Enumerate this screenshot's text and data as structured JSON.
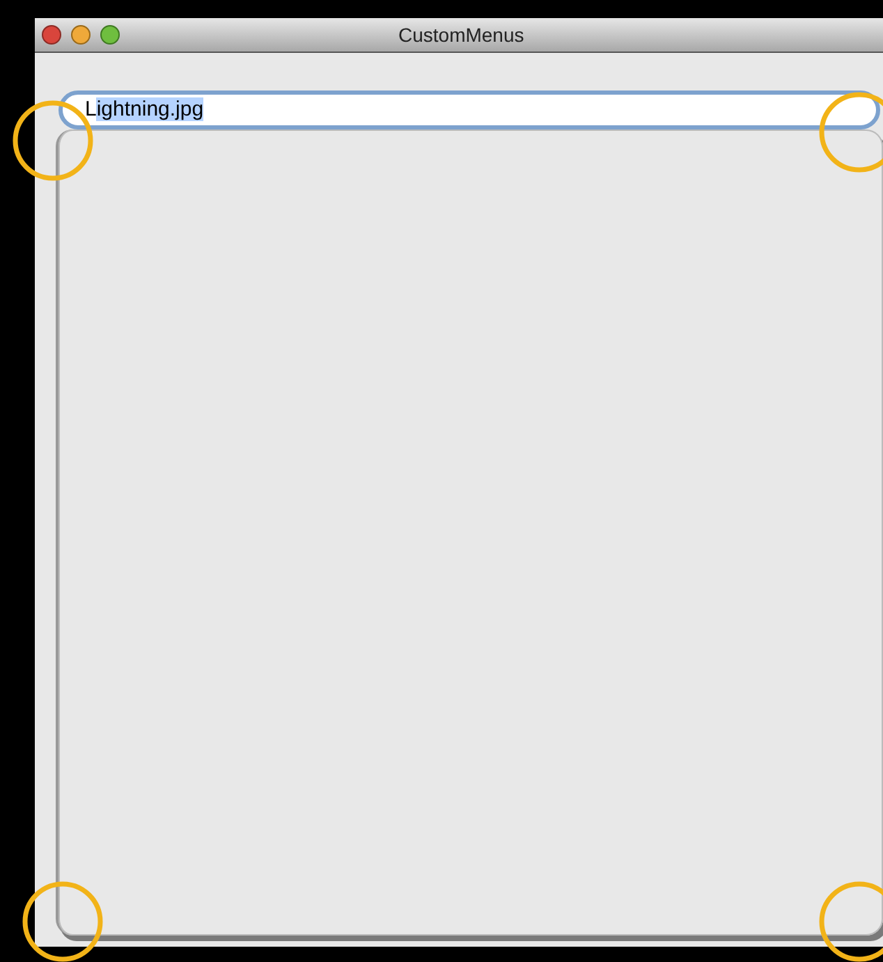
{
  "window": {
    "title": "CustomMenus"
  },
  "text_field": {
    "parts": [
      {
        "text": "L",
        "selected": false
      },
      {
        "text": "ightning.jpg",
        "selected": true
      }
    ]
  },
  "corner_markers": [
    {
      "kind": "circle"
    },
    {
      "kind": "circle"
    },
    {
      "kind": "circle"
    },
    {
      "kind": "circle"
    }
  ]
}
